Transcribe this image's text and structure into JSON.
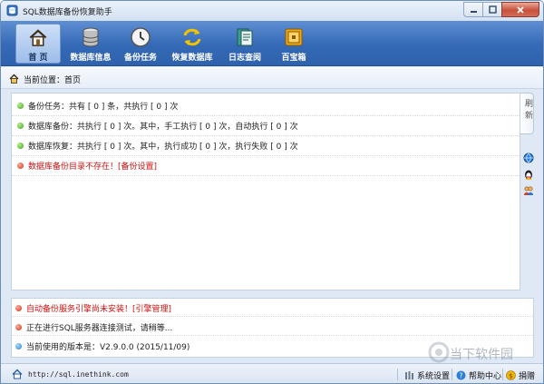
{
  "window": {
    "title": "SQL数据库备份恢复助手"
  },
  "toolbar": {
    "items": [
      {
        "label": "首 页",
        "icon": "home-icon",
        "active": true
      },
      {
        "label": "数据库信息",
        "icon": "database-icon",
        "active": false
      },
      {
        "label": "备份任务",
        "icon": "clock-icon",
        "active": false
      },
      {
        "label": "恢复数据库",
        "icon": "refresh-icon",
        "active": false
      },
      {
        "label": "日志查阅",
        "icon": "log-book-icon",
        "active": false
      },
      {
        "label": "百宝箱",
        "icon": "treasure-box-icon",
        "active": false
      }
    ]
  },
  "breadcrumb": {
    "label": "当前位置：首页"
  },
  "status": {
    "rows": [
      {
        "text": "备份任务：共有 [ 0 ] 条，共执行 [ 0 ] 次",
        "level": "ok"
      },
      {
        "text": "数据库备份：共执行 [ 0 ] 次。其中，手工执行 [ 0 ] 次，自动执行 [ 0 ] 次",
        "level": "ok"
      },
      {
        "text": "数据库恢复：共执行 [ 0 ] 次。其中，执行成功 [ 0 ] 次，执行失败 [ 0 ] 次",
        "level": "ok"
      },
      {
        "text": "数据库备份目录不存在！[备份设置]",
        "level": "error"
      }
    ]
  },
  "sidebar": {
    "refresh_label": "刷新"
  },
  "messages": {
    "rows": [
      {
        "text": "自动备份服务引擎尚未安装！[引擎管理]",
        "level": "error"
      },
      {
        "text": "正在进行SQL服务器连接测试，请稍等...",
        "level": "error"
      },
      {
        "text": "当前使用的版本是：V2.9.0.0 (2015/11/09)",
        "level": "info"
      }
    ]
  },
  "watermark": {
    "text": "当下软件园"
  },
  "statusbar": {
    "url": "http://sql.inethink.com",
    "settings_label": "系统设置",
    "help_label": "帮助中心",
    "donate_label": "捐赠"
  },
  "colors": {
    "toolbar": "#3469b6",
    "error": "#cc1111",
    "ok": "#39a11e",
    "info": "#1f7fd1"
  }
}
